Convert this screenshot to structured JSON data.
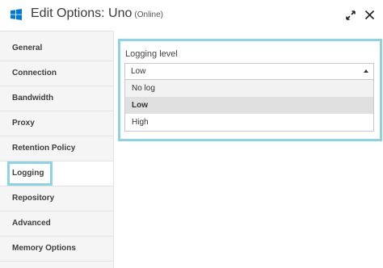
{
  "window": {
    "title": "Edit Options: Uno",
    "status": "(Online)",
    "icons": [
      "windows-logo-icon",
      "expand-icon",
      "close-icon"
    ]
  },
  "nav": {
    "items": [
      {
        "label": "General"
      },
      {
        "label": "Connection"
      },
      {
        "label": "Bandwidth"
      },
      {
        "label": "Proxy"
      },
      {
        "label": "Retention Policy"
      },
      {
        "label": "Logging"
      },
      {
        "label": "Repository"
      },
      {
        "label": "Advanced"
      },
      {
        "label": "Memory Options"
      }
    ],
    "active": "Logging"
  },
  "logging": {
    "label": "Logging level",
    "selected": "Low",
    "options": [
      "No log",
      "Low",
      "High"
    ]
  },
  "colors": {
    "highlight": "#8fd3e3",
    "nav_bg": "#f5f5f5",
    "windows_logo": "#0078d7"
  }
}
